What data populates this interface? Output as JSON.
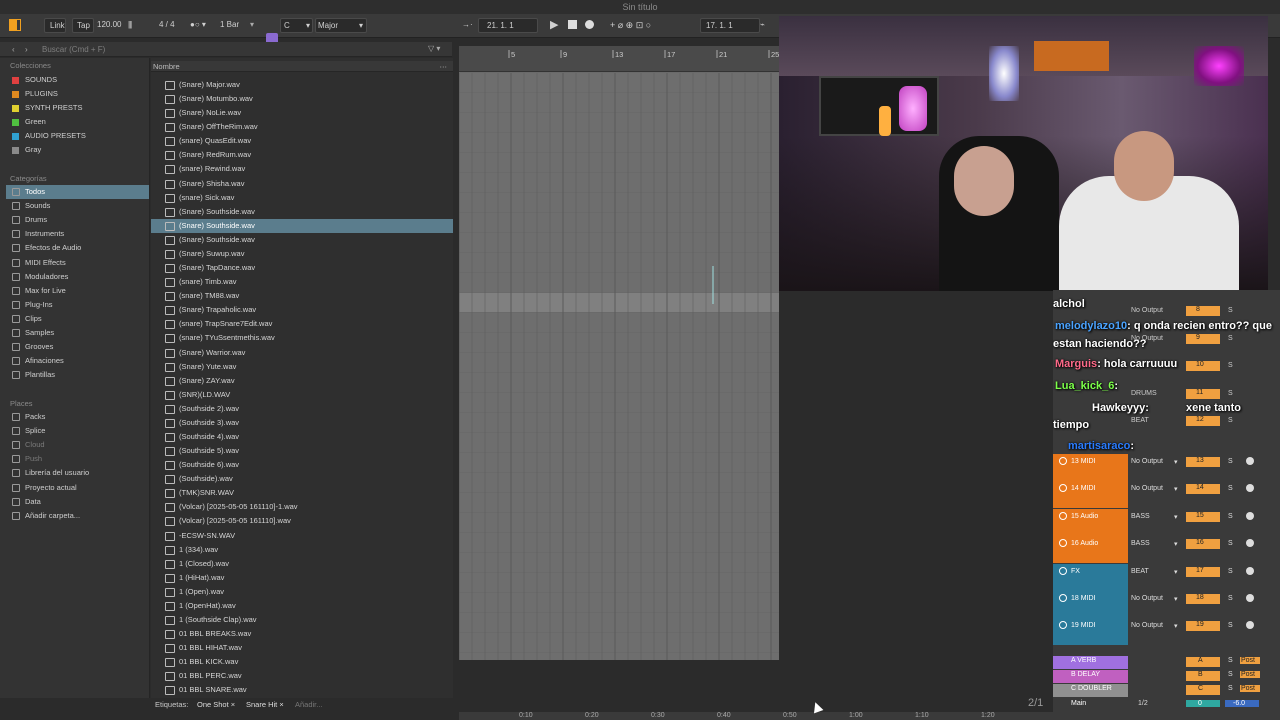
{
  "window": {
    "title": "Sin título"
  },
  "transport": {
    "link": "Link",
    "tap": "Tap",
    "bpm": "120.00",
    "meter": "4 / 4",
    "quant": "1 Bar",
    "key": "C",
    "scale": "Major",
    "position": "21.  1.  1",
    "end": "17.  1.  1"
  },
  "browser": {
    "search_placeholder": "Buscar (Cmd + F)",
    "collections_title": "Colecciones",
    "collections": [
      {
        "label": "SOUNDS",
        "color": "#e04040"
      },
      {
        "label": "PLUGINS",
        "color": "#e08a20"
      },
      {
        "label": "SYNTH PRESTS",
        "color": "#e0d030"
      },
      {
        "label": "Green",
        "color": "#50c040"
      },
      {
        "label": "AUDIO PRESETS",
        "color": "#30a0d0"
      },
      {
        "label": "Gray",
        "color": "#8a8a8a"
      }
    ],
    "categories_title": "Categorías",
    "categories": [
      "Todos",
      "Sounds",
      "Drums",
      "Instruments",
      "Efectos de Audio",
      "MIDI Effects",
      "Moduladores",
      "Max for Live",
      "Plug-Ins",
      "Clips",
      "Samples",
      "Grooves",
      "Afinaciones",
      "Plantillas"
    ],
    "places_title": "Places",
    "places": [
      "Packs",
      "Splice",
      "Cloud",
      "Push",
      "Librería del usuario",
      "Proyecto actual",
      "Data",
      "Añadir carpeta..."
    ],
    "column_header": "Nombre",
    "files": [
      "(Snare) Major.wav",
      "(Snare) Motumbo.wav",
      "(Snare) NoLie.wav",
      "(Snare) OffTheRim.wav",
      "(snare) QuasEdit.wav",
      "(Snare) RedRum.wav",
      "(snare) Rewind.wav",
      "(Snare) Shisha.wav",
      "(snare) Sick.wav",
      "(Snare) Southside.wav",
      "(Snare) Southside.wav",
      "(Snare) Southside.wav",
      "(Snare) Suwup.wav",
      "(Snare) TapDance.wav",
      "(snare) Timb.wav",
      "(snare) TM88.wav",
      "(Snare) Trapaholic.wav",
      "(snare) TrapSnare7Edit.wav",
      "(snare) TYuSsentmethis.wav",
      "(Snare) Warrior.wav",
      "(Snare) Yute.wav",
      "(Snare) ZAY.wav",
      "(SNR)(LD.WAV",
      "(Southside 2).wav",
      "(Southside 3).wav",
      "(Southside 4).wav",
      "(Southside 5).wav",
      "(Southside 6).wav",
      "(Southside).wav",
      "(TMK)SNR.WAV",
      "(Volcar) [2025-05-05 161110]-1.wav",
      "(Volcar) [2025-05-05 161110].wav",
      "-ECSW-SN.WAV",
      "1 (334).wav",
      "1 (Closed).wav",
      "1 (HiHat).wav",
      "1 (Open).wav",
      "1 (OpenHat).wav",
      "1 (Southside Clap).wav",
      "01 BBL BREAKS.wav",
      "01 BBL HIHAT.wav",
      "01 BBL KICK.wav",
      "01 BBL PERC.wav",
      "01 BBL SNARE.wav"
    ],
    "selected_file_index": 10,
    "tags_label": "Etiquetas:",
    "tags": [
      "One Shot",
      "Snare Hit"
    ],
    "add_tag": "Añadir..."
  },
  "arrangement": {
    "bars": [
      "5",
      "9",
      "13",
      "17",
      "21",
      "25"
    ],
    "time_marks": [
      "0:10",
      "0:20",
      "0:30",
      "0:40",
      "0:50",
      "1:00",
      "1:10",
      "1:20"
    ]
  },
  "chat": [
    {
      "user": "",
      "text": "alchol",
      "color": "#ffffff"
    },
    {
      "user": "melodylazo10",
      "text": ": q onda recien entro?? que",
      "color": "#4aa3ff"
    },
    {
      "user": "",
      "text": "estan haciendo??",
      "color": "#ffffff"
    },
    {
      "user": "Marguis",
      "text": ": hola carruuuu",
      "color": "#ff6a8a"
    },
    {
      "user": "Lua_kick_6",
      "text": ":",
      "color": "#7cff4a"
    },
    {
      "user": "Hawkeyyy",
      "text": ":",
      "color": "#ffffff"
    },
    {
      "user": "",
      "text": "xene tanto",
      "color": "#ffffff"
    },
    {
      "user": "",
      "text": "tiempo",
      "color": "#ffffff"
    },
    {
      "user": "martisaraco",
      "text": ":",
      "color": "#2a7cff"
    }
  ],
  "mixer": {
    "page": "2/1",
    "tracks": [
      {
        "name": "13 MIDI",
        "color": "#e8761a",
        "output": "No Output",
        "num": "13"
      },
      {
        "name": "14 MIDI",
        "color": "#e8761a",
        "output": "No Output",
        "num": "14"
      },
      {
        "name": "15 Audio",
        "color": "#e8761a",
        "output": "BASS",
        "num": "15"
      },
      {
        "name": "16 Audio",
        "color": "#e8761a",
        "output": "BASS",
        "num": "16"
      },
      {
        "name": "FX",
        "color": "#2a7a9a",
        "output": "BEAT",
        "num": "17"
      },
      {
        "name": "18 MIDI",
        "color": "#2a7a9a",
        "output": "No Output",
        "num": "18"
      },
      {
        "name": "19 MIDI",
        "color": "#2a7a9a",
        "output": "No Output",
        "num": "19"
      }
    ],
    "upper_rows": [
      {
        "output": "No Output",
        "num": "8"
      },
      {
        "output": "No Output",
        "num": "9"
      },
      {
        "output": "",
        "num": "10"
      },
      {
        "output": "DRUMS",
        "num": "11"
      },
      {
        "output": "BEAT",
        "num": "12"
      }
    ],
    "returns": [
      {
        "name": "A VERB",
        "color": "#a070e0",
        "letter": "A"
      },
      {
        "name": "B DELAY",
        "color": "#c060c0",
        "letter": "B"
      },
      {
        "name": "C DOUBLER",
        "color": "#909090",
        "letter": "C"
      }
    ],
    "main": {
      "name": "Main",
      "io": "1/2",
      "vol": "0",
      "db": "-6.0"
    },
    "solo": "S",
    "post": "Post",
    "c": "C",
    "zero": "0",
    "inf": "-∞"
  }
}
